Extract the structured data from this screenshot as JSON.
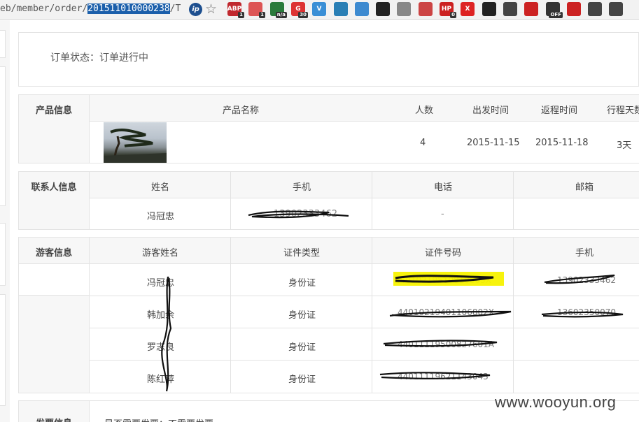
{
  "browser": {
    "url_prefix": "eb/member/order/",
    "url_selected": "201511010000238",
    "url_suffix": "/To",
    "ip_label": "ip",
    "extensions": [
      {
        "icon": "abp-icon",
        "label": "ABP",
        "color": "#c0282e",
        "badge": "1"
      },
      {
        "icon": "chain-icon",
        "label": "",
        "color": "#d55",
        "badge": "1"
      },
      {
        "icon": "chart-icon",
        "label": "",
        "color": "#2a7a3b",
        "badge": "n/a"
      },
      {
        "icon": "g-icon",
        "label": "G",
        "color": "#d33",
        "badge": "30"
      },
      {
        "icon": "v-icon",
        "label": "V",
        "color": "#3a8fd6",
        "badge": ""
      },
      {
        "icon": "bug-icon",
        "label": "",
        "color": "#2a7fb5",
        "badge": ""
      },
      {
        "icon": "cloud-icon",
        "label": "",
        "color": "#3d8ad0",
        "badge": ""
      },
      {
        "icon": "alien-icon",
        "label": "",
        "color": "#222",
        "badge": ""
      },
      {
        "icon": "mask-icon",
        "label": "",
        "color": "#888",
        "badge": ""
      },
      {
        "icon": "tag-icon",
        "label": "",
        "color": "#c44",
        "badge": ""
      },
      {
        "icon": "hp-icon",
        "label": "HP",
        "color": "#c22",
        "badge": "0"
      },
      {
        "icon": "x-icon",
        "label": "X",
        "color": "#d22",
        "badge": ""
      },
      {
        "icon": "spider-icon",
        "label": "",
        "color": "#222",
        "badge": ""
      },
      {
        "icon": "spy-icon",
        "label": "",
        "color": "#444",
        "badge": ""
      },
      {
        "icon": "devil-icon",
        "label": "",
        "color": "#c22",
        "badge": ""
      },
      {
        "icon": "glasses-icon",
        "label": "",
        "color": "#333",
        "badge": "OFF"
      },
      {
        "icon": "target-icon",
        "label": "",
        "color": "#c22",
        "badge": ""
      },
      {
        "icon": "grid-icon",
        "label": "",
        "color": "#444",
        "badge": ""
      },
      {
        "icon": "menu-icon",
        "label": "",
        "color": "#444",
        "badge": ""
      }
    ]
  },
  "order_status": "订单状态：订单进行中",
  "product": {
    "section_label": "产品信息",
    "headers": [
      "产品名称",
      "人数",
      "出发时间",
      "返程时间",
      "行程天数"
    ],
    "row": {
      "count": "4",
      "depart": "2015-11-15",
      "return": "2015-11-18",
      "days": "3天"
    }
  },
  "contact": {
    "section_label": "联系人信息",
    "headers": [
      "姓名",
      "手机",
      "电话",
      "邮箱"
    ],
    "row": {
      "name": "冯冠忠",
      "mobile": "13902333462",
      "phone": "-",
      "email": ""
    }
  },
  "travelers": {
    "section_label": "游客信息",
    "headers": [
      "游客姓名",
      "证件类型",
      "证件号码",
      "手机"
    ],
    "rows": [
      {
        "name": "冯冠忠",
        "id_type": "身份证",
        "id_no": "44010219510810505X",
        "mobile": "13902333462"
      },
      {
        "name": "韩加余",
        "id_type": "身份证",
        "id_no": "44010219401106802X",
        "mobile": "13602350070"
      },
      {
        "name": "罗志良",
        "id_type": "身份证",
        "id_no": "44011119500827601A",
        "mobile": ""
      },
      {
        "name": "陈红萍",
        "id_type": "身份证",
        "id_no": "44011119621143043",
        "mobile": ""
      }
    ]
  },
  "invoice": {
    "section_label": "发票信息",
    "text": "是否需要发票：不需要发票"
  },
  "watermark": "www.wooyun.org"
}
